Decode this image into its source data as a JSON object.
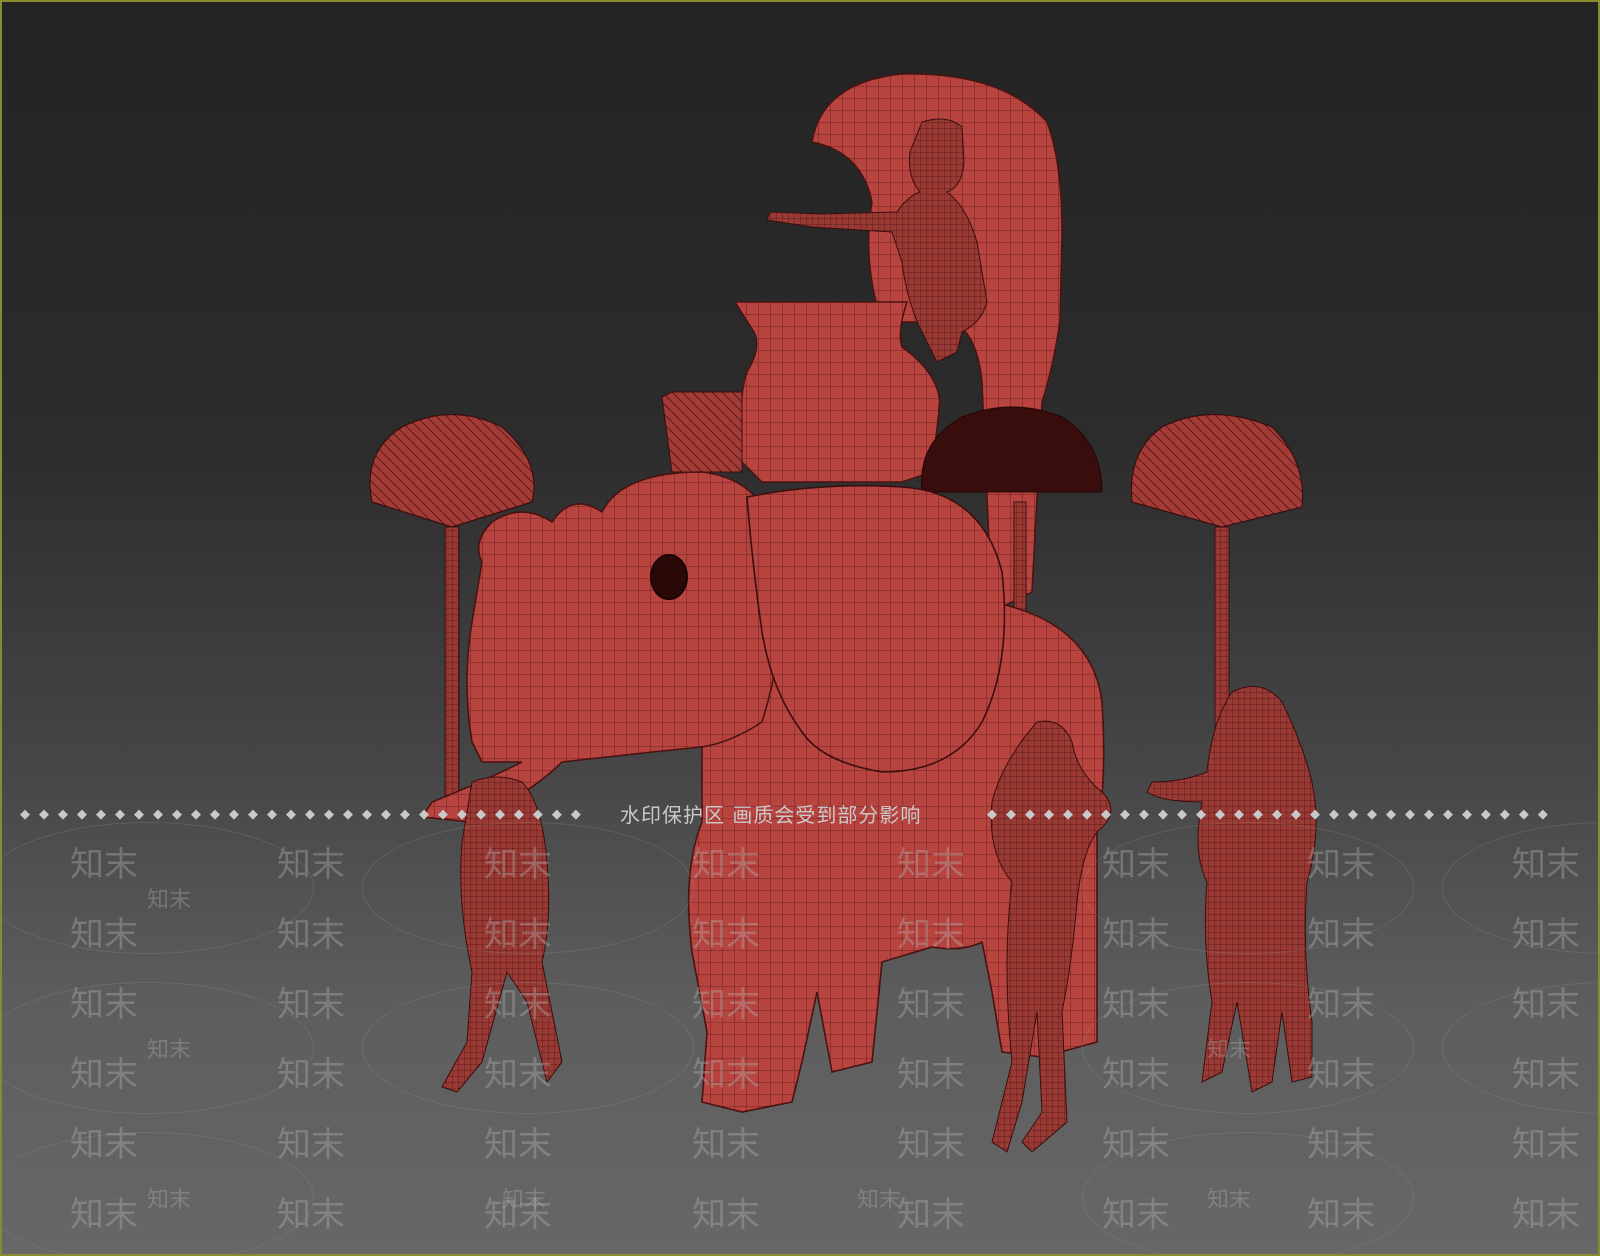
{
  "viewport": {
    "watermark_notice": "水印保护区  画质会受到部分影响",
    "watermark_brand": "知末",
    "dots": "◆◆◆◆◆◆◆◆◆◆◆◆◆◆◆◆◆◆◆◆◆◆◆◆◆◆◆◆◆◆"
  },
  "colors": {
    "model_fill": "#b8443f",
    "wire": "#4a1212",
    "background_top": "#232323",
    "background_bottom": "#676767"
  },
  "scene": {
    "subject_icon": "elephant-float-wireframe-model"
  }
}
